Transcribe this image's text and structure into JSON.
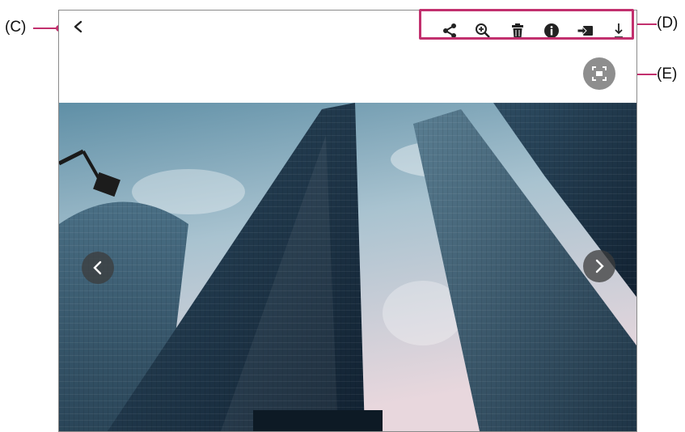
{
  "callouts": {
    "c": "(C)",
    "d": "(D)",
    "e": "(E)"
  },
  "colors": {
    "callout_line": "#c2306e",
    "frame_border": "#8a8a8a",
    "fit_button": "#8e8e8e"
  },
  "toolbar": {
    "icons": [
      "share-icon",
      "zoom-in-icon",
      "delete-icon",
      "info-icon",
      "send-to-device-icon",
      "download-icon"
    ]
  },
  "viewer": {
    "back_icon": "chevron-left-icon",
    "fit_icon": "fit-screen-icon",
    "prev_icon": "chevron-left-icon",
    "next_icon": "chevron-right-icon"
  }
}
